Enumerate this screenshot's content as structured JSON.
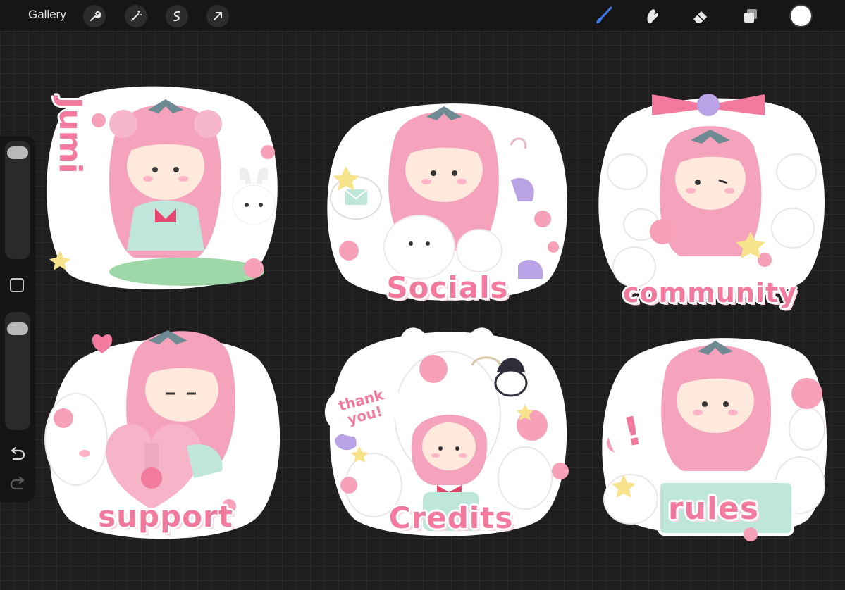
{
  "toolbar": {
    "gallery_label": "Gallery",
    "left_tools": [
      "wrench-icon",
      "magic-wand-icon",
      "selection-icon",
      "transform-arrow-icon"
    ],
    "right_tools": [
      "brush-icon",
      "smudge-icon",
      "eraser-icon",
      "layers-icon",
      "color-well"
    ],
    "active_tool": "brush-icon",
    "active_color": "#3f7ef0",
    "current_color": "#ffffff"
  },
  "sidebar": {
    "controls": [
      "brush-size-slider",
      "modify-button",
      "opacity-slider",
      "undo-icon",
      "redo-icon"
    ]
  },
  "stickers": [
    {
      "label": "Jumi"
    },
    {
      "label": "Socials"
    },
    {
      "label": "community"
    },
    {
      "label": "support"
    },
    {
      "label": "Credits",
      "bubble": "thank you!"
    },
    {
      "label": "rules",
      "bubble": "!"
    }
  ],
  "colors": {
    "pink": "#f27a9e",
    "hair": "#f5a3bd",
    "white": "#ffffff",
    "mint": "#bfe6da",
    "lavender": "#b9a3e6"
  }
}
